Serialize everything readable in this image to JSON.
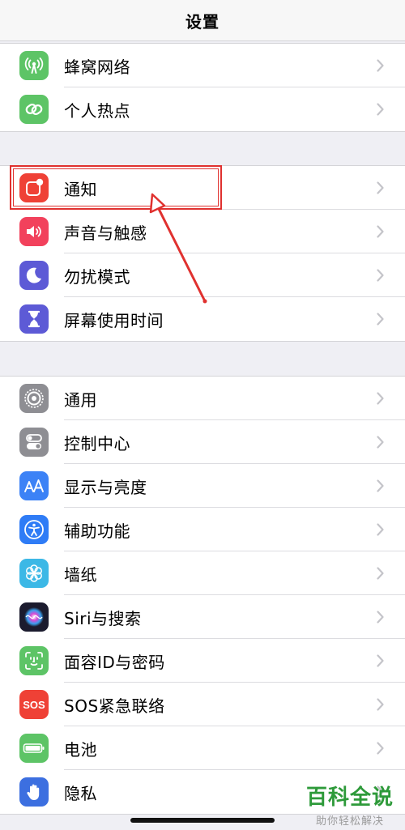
{
  "navbar": {
    "title": "设置"
  },
  "groups": [
    {
      "items": [
        {
          "label": "蜂窝网络",
          "icon": "antenna-icon",
          "color": "#5dc466"
        },
        {
          "label": "个人热点",
          "icon": "chain-link-icon",
          "color": "#5dc466"
        }
      ]
    },
    {
      "items": [
        {
          "label": "通知",
          "icon": "notification-icon",
          "color": "#ef4136"
        },
        {
          "label": "声音与触感",
          "icon": "speaker-icon",
          "color": "#f2415c"
        },
        {
          "label": "勿扰模式",
          "icon": "moon-icon",
          "color": "#5d5ad6"
        },
        {
          "label": "屏幕使用时间",
          "icon": "hourglass-icon",
          "color": "#5d5ad6"
        }
      ]
    },
    {
      "items": [
        {
          "label": "通用",
          "icon": "gear-icon",
          "color": "#8e8e93"
        },
        {
          "label": "控制中心",
          "icon": "toggles-icon",
          "color": "#8e8e93"
        },
        {
          "label": "显示与亮度",
          "icon": "text-size-icon",
          "color": "#3c82f6"
        },
        {
          "label": "辅助功能",
          "icon": "accessibility-icon",
          "color": "#2f7cf6"
        },
        {
          "label": "墙纸",
          "icon": "flower-icon",
          "color": "#3cb8e6"
        },
        {
          "label": "Siri与搜索",
          "icon": "siri-icon",
          "color": "#1b1b2e"
        },
        {
          "label": "面容ID与密码",
          "icon": "face-id-icon",
          "color": "#5dc466"
        },
        {
          "label": "SOS紧急联络",
          "icon": "sos-icon",
          "color": "#ef4136",
          "icon_text": "SOS"
        },
        {
          "label": "电池",
          "icon": "battery-icon",
          "color": "#5dc466"
        },
        {
          "label": "隐私",
          "icon": "hand-icon",
          "color": "#3c6fe0"
        }
      ]
    }
  ],
  "watermark": {
    "main": "百科全说",
    "sub": "助你轻松解决"
  }
}
